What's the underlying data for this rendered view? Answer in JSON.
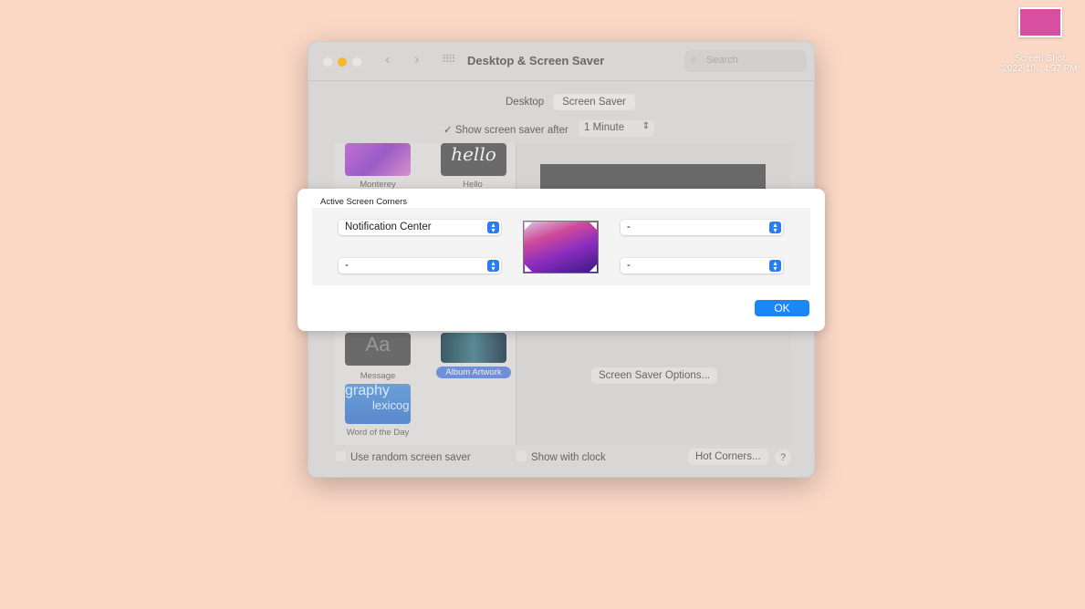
{
  "desktop_icon": {
    "name_line1": "Screen Shot",
    "name_line2": "2022-10...4.37 PM"
  },
  "window": {
    "title": "Desktop & Screen Saver",
    "search_placeholder": "Search",
    "tabs": [
      {
        "label": "Desktop",
        "selected": false
      },
      {
        "label": "Screen Saver",
        "selected": true
      }
    ],
    "show_after_label": "Show screen saver after",
    "show_after_checked": true,
    "show_after_value": "1 Minute",
    "savers": [
      {
        "label": "Monterey"
      },
      {
        "label": "Hello",
        "thumb_text": "hello"
      },
      {
        "label": "Message",
        "thumb_text": "Aa"
      },
      {
        "label": "Album Artwork",
        "selected": true
      },
      {
        "label": "Word of the Day",
        "thumb_text1": "graphy",
        "thumb_text2": "lexicog"
      }
    ],
    "options_button": "Screen Saver Options...",
    "random_label": "Use random screen saver",
    "clock_label": "Show with clock",
    "hot_corners_button": "Hot Corners...",
    "help": "?"
  },
  "dialog": {
    "title": "Active Screen Corners",
    "top_left": "Notification Center",
    "top_right": "-",
    "bottom_left": "-",
    "bottom_right": "-",
    "ok": "OK",
    "accent": "#1b86f8"
  }
}
